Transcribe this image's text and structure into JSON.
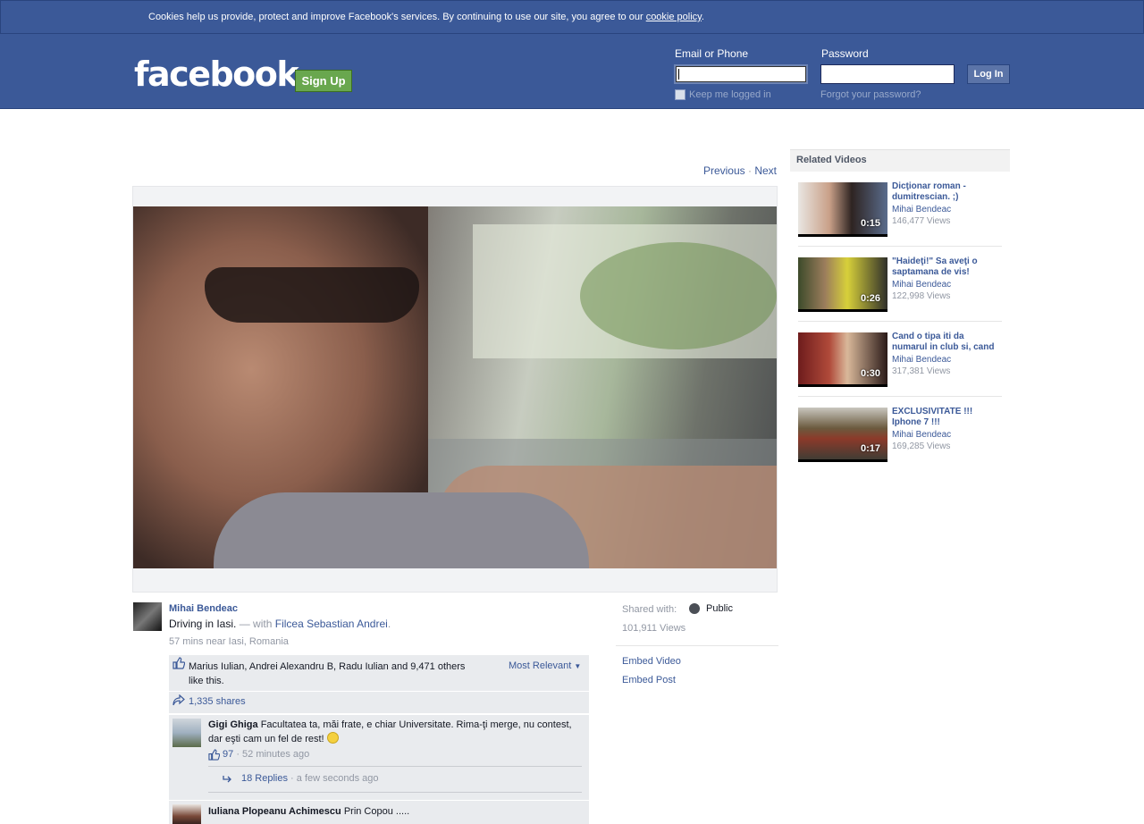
{
  "cookie": {
    "text": "Cookies help us provide, protect and improve Facebook's services. By continuing to use our site, you agree to our ",
    "link": "cookie policy",
    "end": "."
  },
  "header": {
    "logo": "facebook",
    "signup": "Sign Up",
    "email_label": "Email or Phone",
    "email_value": "",
    "password_label": "Password",
    "password_value": "",
    "login": "Log In",
    "keep_logged": "Keep me logged in",
    "forgot": "Forgot your password?"
  },
  "nav": {
    "previous": "Previous",
    "sep": "·",
    "next": "Next"
  },
  "post": {
    "author": "Mihai Bendeac",
    "caption": "Driving in Iasi.",
    "with_prefix": "— with",
    "with_name": "Filcea Sebastian Andrei",
    "with_end": ".",
    "meta": "57 mins near Iasi, Romania",
    "likes_text": "Marius Iulian, Andrei Alexandru B, Radu Iulian and 9,471 others like this.",
    "sort": "Most Relevant",
    "shares": "1,335 shares"
  },
  "comments": [
    {
      "name": "Gigi Ghiga",
      "text": "Facultatea ta, măi frate, e chiar Universitate. Rima-ţi merge, nu contest, dar eşti cam un fel de rest!",
      "likes": "97",
      "time": "· 52 minutes ago",
      "replies": "18 Replies",
      "replies_time": "· a few seconds ago"
    },
    {
      "name": "Iuliana Plopeanu Achimescu",
      "text": "Prin Copou ....."
    }
  ],
  "info": {
    "shared_label": "Shared with:",
    "privacy": "Public",
    "views": "101,911 Views",
    "embed_video": "Embed Video",
    "embed_post": "Embed Post"
  },
  "related": {
    "title": "Related Videos",
    "items": [
      {
        "title": "Dicţionar roman - dumitrescian. ;)",
        "author": "Mihai Bendeac",
        "views": "146,477 Views",
        "duration": "0:15"
      },
      {
        "title": "\"Haideţi!\" Sa aveţi o saptamana de vis!",
        "author": "Mihai Bendeac",
        "views": "122,998 Views",
        "duration": "0:26"
      },
      {
        "title": "Cand o tipa iti da numarul in club si, cand",
        "author": "Mihai Bendeac",
        "views": "317,381 Views",
        "duration": "0:30"
      },
      {
        "title": "EXCLUSIVITATE !!! Iphone 7 !!!",
        "author": "Mihai Bendeac",
        "views": "169,285 Views",
        "duration": "0:17"
      }
    ]
  }
}
